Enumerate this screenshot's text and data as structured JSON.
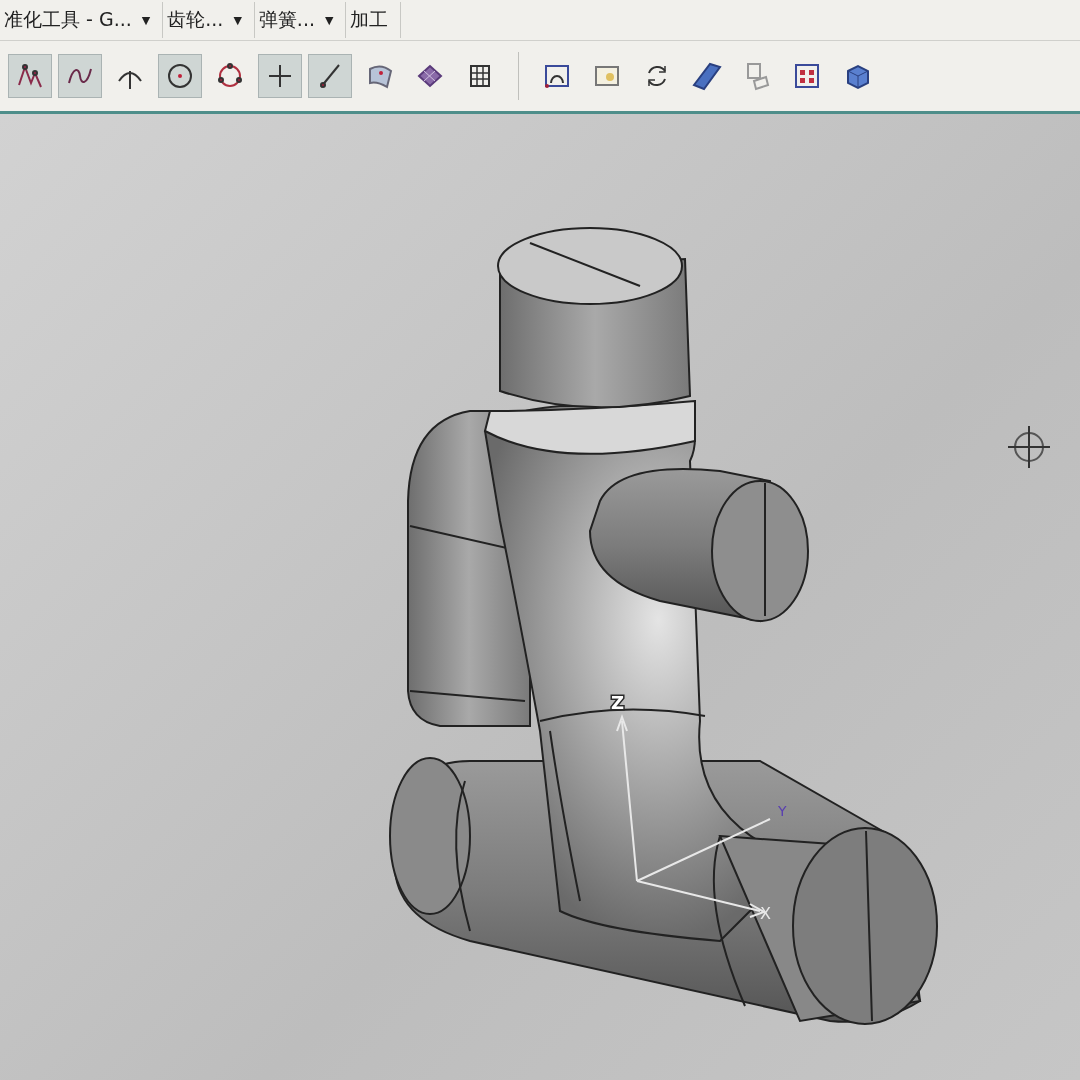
{
  "menu_bar": [
    {
      "label": "准化工具 - G...",
      "dropdown": true
    },
    {
      "label": "齿轮...",
      "dropdown": true
    },
    {
      "label": "弹簧...",
      "dropdown": true
    },
    {
      "label": "加工",
      "dropdown": false
    }
  ],
  "dropdown_arrow": "▼",
  "toolbar": {
    "left_tools": [
      {
        "kind": "spline",
        "pressed": true
      },
      {
        "kind": "wave",
        "pressed": true
      },
      {
        "kind": "arc",
        "pressed": false
      },
      {
        "kind": "circle_center",
        "pressed": true
      },
      {
        "kind": "circle_points",
        "pressed": false
      },
      {
        "kind": "cross",
        "pressed": true
      },
      {
        "kind": "line",
        "pressed": true
      },
      {
        "kind": "surface_point",
        "pressed": false
      },
      {
        "kind": "mesh",
        "pressed": false
      },
      {
        "kind": "grid",
        "pressed": false
      }
    ],
    "right_tools": [
      {
        "kind": "fit_view",
        "pressed": false
      },
      {
        "kind": "picture",
        "pressed": false
      },
      {
        "kind": "refresh",
        "pressed": false
      },
      {
        "kind": "block",
        "pressed": false
      },
      {
        "kind": "views",
        "pressed": false
      },
      {
        "kind": "layout",
        "pressed": false
      },
      {
        "kind": "cube",
        "pressed": false
      }
    ]
  },
  "viewport": {
    "triad": {
      "z_label": "Z",
      "x_label": "X",
      "y_label": "Y"
    }
  }
}
